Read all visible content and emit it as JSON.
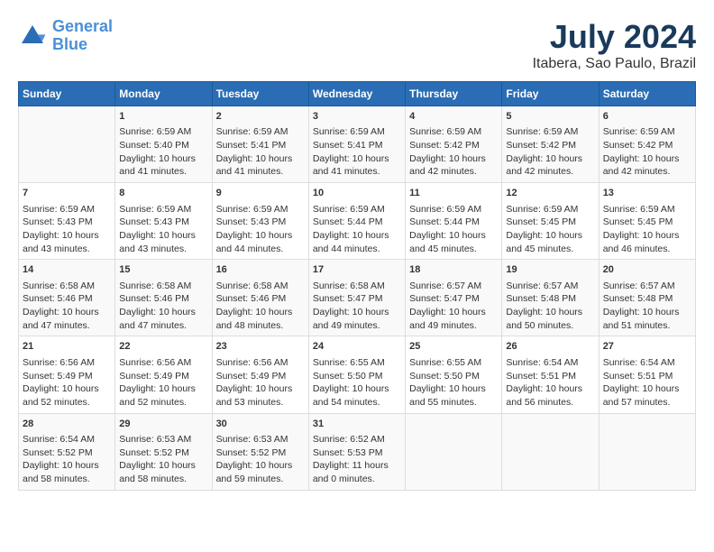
{
  "header": {
    "logo_line1": "General",
    "logo_line2": "Blue",
    "title": "July 2024",
    "subtitle": "Itabera, Sao Paulo, Brazil"
  },
  "days_of_week": [
    "Sunday",
    "Monday",
    "Tuesday",
    "Wednesday",
    "Thursday",
    "Friday",
    "Saturday"
  ],
  "weeks": [
    [
      {
        "day": "",
        "content": ""
      },
      {
        "day": "1",
        "content": "Sunrise: 6:59 AM\nSunset: 5:40 PM\nDaylight: 10 hours\nand 41 minutes."
      },
      {
        "day": "2",
        "content": "Sunrise: 6:59 AM\nSunset: 5:41 PM\nDaylight: 10 hours\nand 41 minutes."
      },
      {
        "day": "3",
        "content": "Sunrise: 6:59 AM\nSunset: 5:41 PM\nDaylight: 10 hours\nand 41 minutes."
      },
      {
        "day": "4",
        "content": "Sunrise: 6:59 AM\nSunset: 5:42 PM\nDaylight: 10 hours\nand 42 minutes."
      },
      {
        "day": "5",
        "content": "Sunrise: 6:59 AM\nSunset: 5:42 PM\nDaylight: 10 hours\nand 42 minutes."
      },
      {
        "day": "6",
        "content": "Sunrise: 6:59 AM\nSunset: 5:42 PM\nDaylight: 10 hours\nand 42 minutes."
      }
    ],
    [
      {
        "day": "7",
        "content": ""
      },
      {
        "day": "8",
        "content": "Sunrise: 6:59 AM\nSunset: 5:43 PM\nDaylight: 10 hours\nand 43 minutes."
      },
      {
        "day": "9",
        "content": "Sunrise: 6:59 AM\nSunset: 5:43 PM\nDaylight: 10 hours\nand 44 minutes."
      },
      {
        "day": "10",
        "content": "Sunrise: 6:59 AM\nSunset: 5:44 PM\nDaylight: 10 hours\nand 44 minutes."
      },
      {
        "day": "11",
        "content": "Sunrise: 6:59 AM\nSunset: 5:44 PM\nDaylight: 10 hours\nand 45 minutes."
      },
      {
        "day": "12",
        "content": "Sunrise: 6:59 AM\nSunset: 5:45 PM\nDaylight: 10 hours\nand 45 minutes."
      },
      {
        "day": "13",
        "content": "Sunrise: 6:59 AM\nSunset: 5:45 PM\nDaylight: 10 hours\nand 46 minutes."
      }
    ],
    [
      {
        "day": "14",
        "content": ""
      },
      {
        "day": "15",
        "content": "Sunrise: 6:58 AM\nSunset: 5:46 PM\nDaylight: 10 hours\nand 47 minutes."
      },
      {
        "day": "16",
        "content": "Sunrise: 6:58 AM\nSunset: 5:46 PM\nDaylight: 10 hours\nand 48 minutes."
      },
      {
        "day": "17",
        "content": "Sunrise: 6:58 AM\nSunset: 5:47 PM\nDaylight: 10 hours\nand 49 minutes."
      },
      {
        "day": "18",
        "content": "Sunrise: 6:57 AM\nSunset: 5:47 PM\nDaylight: 10 hours\nand 49 minutes."
      },
      {
        "day": "19",
        "content": "Sunrise: 6:57 AM\nSunset: 5:48 PM\nDaylight: 10 hours\nand 50 minutes."
      },
      {
        "day": "20",
        "content": "Sunrise: 6:57 AM\nSunset: 5:48 PM\nDaylight: 10 hours\nand 51 minutes."
      }
    ],
    [
      {
        "day": "21",
        "content": ""
      },
      {
        "day": "22",
        "content": "Sunrise: 6:56 AM\nSunset: 5:49 PM\nDaylight: 10 hours\nand 52 minutes."
      },
      {
        "day": "23",
        "content": "Sunrise: 6:56 AM\nSunset: 5:49 PM\nDaylight: 10 hours\nand 53 minutes."
      },
      {
        "day": "24",
        "content": "Sunrise: 6:55 AM\nSunset: 5:50 PM\nDaylight: 10 hours\nand 54 minutes."
      },
      {
        "day": "25",
        "content": "Sunrise: 6:55 AM\nSunset: 5:50 PM\nDaylight: 10 hours\nand 55 minutes."
      },
      {
        "day": "26",
        "content": "Sunrise: 6:54 AM\nSunset: 5:51 PM\nDaylight: 10 hours\nand 56 minutes."
      },
      {
        "day": "27",
        "content": "Sunrise: 6:54 AM\nSunset: 5:51 PM\nDaylight: 10 hours\nand 57 minutes."
      }
    ],
    [
      {
        "day": "28",
        "content": "Sunrise: 6:54 AM\nSunset: 5:52 PM\nDaylight: 10 hours\nand 58 minutes."
      },
      {
        "day": "29",
        "content": "Sunrise: 6:53 AM\nSunset: 5:52 PM\nDaylight: 10 hours\nand 58 minutes."
      },
      {
        "day": "30",
        "content": "Sunrise: 6:53 AM\nSunset: 5:52 PM\nDaylight: 10 hours\nand 59 minutes."
      },
      {
        "day": "31",
        "content": "Sunrise: 6:52 AM\nSunset: 5:53 PM\nDaylight: 11 hours\nand 0 minutes."
      },
      {
        "day": "",
        "content": ""
      },
      {
        "day": "",
        "content": ""
      },
      {
        "day": "",
        "content": ""
      }
    ]
  ],
  "week7_sun": "Sunrise: 6:59 AM\nSunset: 5:43 PM\nDaylight: 10 hours\nand 43 minutes.",
  "week14_sun": "Sunrise: 6:58 AM\nSunset: 5:46 PM\nDaylight: 10 hours\nand 47 minutes.",
  "week21_sun": "Sunrise: 6:56 AM\nSunset: 5:49 PM\nDaylight: 10 hours\nand 52 minutes."
}
